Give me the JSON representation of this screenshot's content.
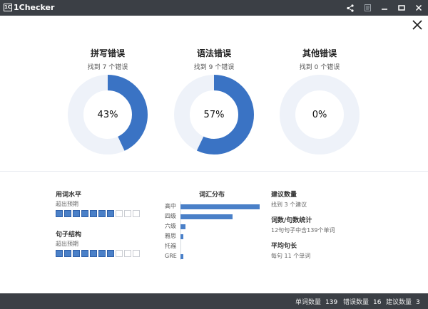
{
  "window": {
    "title": "1Checker",
    "logo_text": "1C"
  },
  "colors": {
    "titlebar": "#3b3f45",
    "accent": "#3a73c4",
    "ring_track": "#eef2f9",
    "segment_on": "#4a80c8"
  },
  "cards": [
    {
      "title": "拼写错误",
      "subtitle": "找到 7 个错误",
      "percent": 43,
      "percent_label": "43%"
    },
    {
      "title": "语法错误",
      "subtitle": "找到 9 个错误",
      "percent": 57,
      "percent_label": "57%"
    },
    {
      "title": "其他错误",
      "subtitle": "找到 0 个错误",
      "percent": 0,
      "percent_label": "0%"
    }
  ],
  "levels": {
    "vocab_level": {
      "title": "用词水平",
      "subtitle": "超出预期",
      "filled": 7,
      "total": 10
    },
    "sentence_structure": {
      "title": "句子结构",
      "subtitle": "超出预期",
      "filled": 7,
      "total": 10
    }
  },
  "vocab_distribution": {
    "title": "词汇分布",
    "rows": [
      {
        "label": "高中",
        "value": 1.0
      },
      {
        "label": "四级",
        "value": 0.66
      },
      {
        "label": "六级",
        "value": 0.06
      },
      {
        "label": "雅思",
        "value": 0.04
      },
      {
        "label": "托福",
        "value": 0
      },
      {
        "label": "GRE",
        "value": 0.04
      }
    ]
  },
  "right_stats": {
    "suggestions": {
      "title": "建议数量",
      "value": "找到 3 个建议"
    },
    "word_sentence": {
      "title": "词数/句数统计",
      "value": "12句句子中含139个单词"
    },
    "avg_length": {
      "title": "平均句长",
      "value": "每句 11 个单词"
    }
  },
  "status_bar": {
    "word_count_label": "单词数量",
    "word_count": "139",
    "error_count_label": "错误数量",
    "error_count": "16",
    "suggestion_count_label": "建议数量",
    "suggestion_count": "3"
  },
  "icons": {
    "titlebar": [
      "share-icon",
      "document-icon",
      "minimize-icon",
      "maximize-icon",
      "close-icon"
    ],
    "dialog_close": "close-x-icon"
  }
}
